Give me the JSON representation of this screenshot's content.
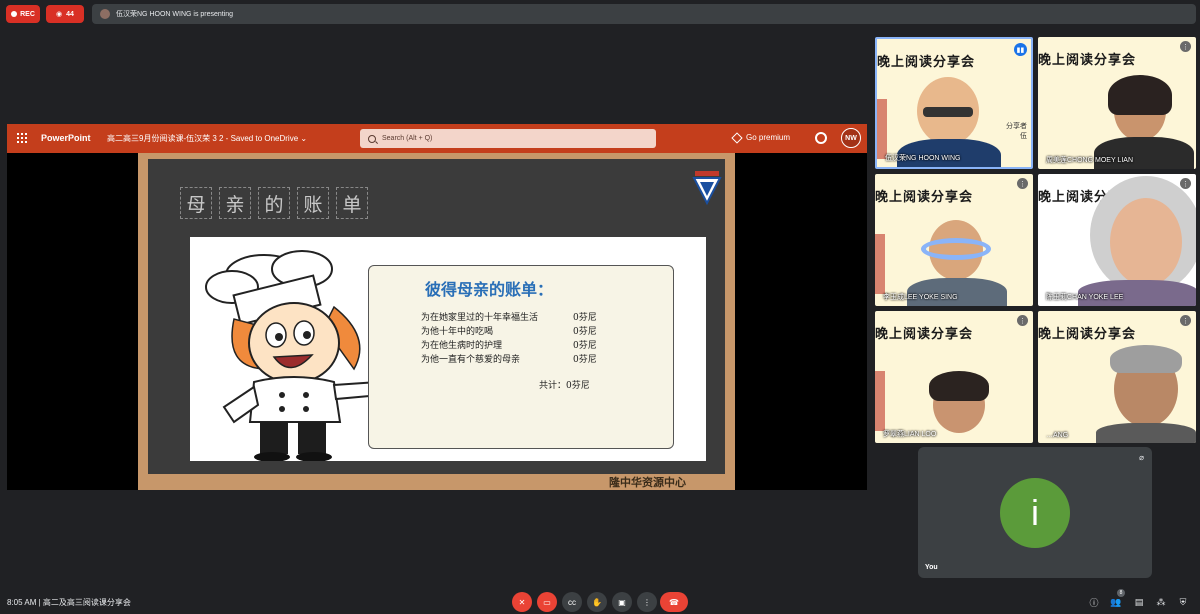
{
  "top": {
    "rec_label": "REC",
    "viewers_count": "44",
    "presenting_text": "伍汉荣NG HOON WING is presenting"
  },
  "ppt": {
    "app_name": "PowerPoint",
    "doc_title": "高二高三9月份阅读课-伍汉荣 3 2 - Saved to OneDrive ⌄",
    "search_placeholder": "Search (Alt + Q)",
    "premium_label": "Go premium",
    "user_initials": "NW"
  },
  "slide": {
    "title_chars": [
      "母",
      "亲",
      "的",
      "账",
      "单"
    ],
    "scroll_title": "彼得母亲的账单：",
    "lines": [
      {
        "text": "为在她家里过的十年幸福生活",
        "amount": "0芬尼"
      },
      {
        "text": "为他十年中的吃喝",
        "amount": "0芬尼"
      },
      {
        "text": "为在他生病时的护理",
        "amount": "0芬尼"
      },
      {
        "text": "为他一直有个慈爱的母亲",
        "amount": "0芬尼"
      }
    ],
    "total": "共计：0芬尼",
    "credit": "隆中华资源中心"
  },
  "tiles": [
    {
      "banner": "晚上阅读分享会",
      "name": "伍汉荣NG HOON WING",
      "note1": "分享者",
      "note2": "伍"
    },
    {
      "banner": "晚上阅读分享会",
      "name": "周美莲CHONG MOEY LIAN"
    },
    {
      "banner": "晚上阅读分享会",
      "name": "李玉成LEE YOKE SING"
    },
    {
      "banner": "晚上阅读分享会",
      "name": "陈玉莉CHAN YOKE LEE"
    },
    {
      "banner": "晚上阅读分享会",
      "name": "罗翠燕LIAN LOO"
    },
    {
      "banner": "晚上阅读分享会",
      "name": "…ANG"
    }
  ],
  "you": {
    "initial": "i",
    "label": "You"
  },
  "bottom": {
    "time_meeting": "8:05 AM  |  高二及高三阅读课分享会",
    "people_count": "8"
  },
  "colors": {
    "ppt_accent": "#c43e1c",
    "rec_red": "#d93025",
    "end_call_red": "#ea4335",
    "you_avatar_green": "#5b9b3a",
    "active_speaker_blue": "#8ab4f8"
  }
}
